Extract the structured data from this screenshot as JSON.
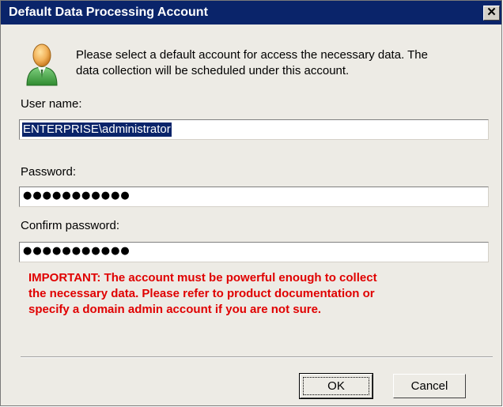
{
  "dialog": {
    "title": "Default Data Processing Account",
    "close_glyph": "✕",
    "icon": "user-icon",
    "intro_line1": "Please select a default account for access the necessary data. The",
    "intro_line2": "data collection will be scheduled under this account.",
    "username_label": "User name:",
    "username_value": "ENTERPRISE\\administrator",
    "password_label": "Password:",
    "password_mask": "●●●●●●●●●●●",
    "confirm_label": "Confirm password:",
    "confirm_mask": "●●●●●●●●●●●",
    "warning_line1": "IMPORTANT: The account must be powerful enough to collect",
    "warning_line2": "the necessary data. Please refer to  product documentation or",
    "warning_line3": "specify a domain admin account if you are not sure.",
    "ok_label": "OK",
    "cancel_label": "Cancel"
  },
  "colors": {
    "titlebar": "#0a246a",
    "warning": "#e00000",
    "selection": "#0a246a"
  }
}
